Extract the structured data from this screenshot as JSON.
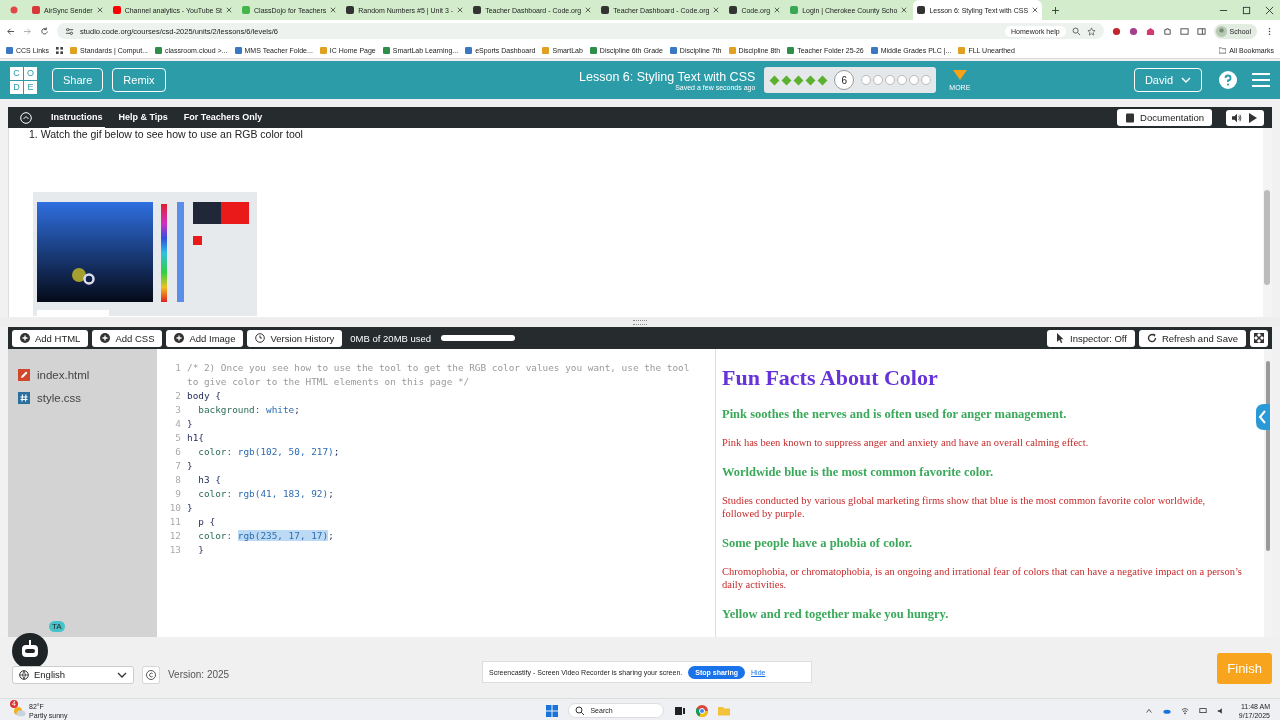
{
  "browser": {
    "tabs": [
      {
        "title": "AirSync Sender",
        "selected": false,
        "color": "#d9383a"
      },
      {
        "title": "Channel analytics - YouTube St",
        "selected": false,
        "color": "#ff0000"
      },
      {
        "title": "ClassDojo for Teachers",
        "selected": false,
        "color": "#43b649"
      },
      {
        "title": "Random Numbers #5 | Unit 3 -",
        "selected": false,
        "color": "#333333"
      },
      {
        "title": "Teacher Dashboard - Code.org",
        "selected": false,
        "color": "#333333"
      },
      {
        "title": "Teacher Dashboard - Code.org",
        "selected": false,
        "color": "#333333"
      },
      {
        "title": "Code.org",
        "selected": false,
        "color": "#333333"
      },
      {
        "title": "Login | Cherokee County Scho",
        "selected": false,
        "color": "#3aa757"
      },
      {
        "title": "Lesson 6: Styling Text with CSS",
        "selected": true,
        "color": "#333333"
      }
    ],
    "address": "studio.code.org/courses/csd-2025/units/2/lessons/6/levels/6",
    "homework_help": "Homework help",
    "profile": "School",
    "bookmarks": [
      "CCS Links",
      "Standards | Comput...",
      "classroom.cloud >...",
      "MMS Teacher Folde...",
      "IC Home Page",
      "SmartLab Learning...",
      "eSports Dashboard",
      "SmartLab",
      "Discipline 6th Grade",
      "Discipline 7th",
      "Discipline 8th",
      "Teacher Folder 25-26",
      "Middle Grades PLC |...",
      "FLL Unearthed"
    ],
    "all_bookmarks": "All Bookmarks"
  },
  "header": {
    "logo_letters": [
      "C",
      "O",
      "D",
      "E"
    ],
    "buttons": [
      "Share",
      "Remix"
    ],
    "lesson_title": "Lesson 6: Styling Text with CSS",
    "save_status": "Saved a few seconds ago",
    "levels": [
      {
        "kind": "done"
      },
      {
        "kind": "done"
      },
      {
        "kind": "done"
      },
      {
        "kind": "done"
      },
      {
        "kind": "done"
      },
      {
        "kind": "current",
        "label": "6"
      },
      {
        "kind": "todo"
      },
      {
        "kind": "todo"
      },
      {
        "kind": "todo"
      },
      {
        "kind": "todo"
      },
      {
        "kind": "todo"
      },
      {
        "kind": "todo"
      }
    ],
    "more": "MORE",
    "user": "David"
  },
  "instructions_bar": {
    "tabs": [
      {
        "label": "Instructions",
        "selected": true
      },
      {
        "label": "Help & Tips",
        "selected": false
      },
      {
        "label": "For Teachers Only",
        "selected": false
      }
    ],
    "documentation": "Documentation"
  },
  "instructions": {
    "step": "1. Watch the gif below to see how to use an RGB color tool"
  },
  "editor_toolbar": {
    "buttons": [
      "Add HTML",
      "Add CSS",
      "Add Image",
      "Version History"
    ],
    "storage": "0MB of 20MB used",
    "right_buttons": [
      "Inspector: Off",
      "Refresh and Save"
    ]
  },
  "files": [
    {
      "name": "index.html",
      "kind": "html"
    },
    {
      "name": "style.css",
      "kind": "css"
    }
  ],
  "code": [
    {
      "n": "1",
      "tokens": [
        {
          "kind": "comment",
          "text": "/* 2) Once you see how to use the tool to get the RGB color values you want, use the tool to give color to the HTML elements on this page */"
        }
      ]
    },
    {
      "n": "2",
      "tokens": [
        {
          "kind": "selector",
          "text": "body {"
        }
      ]
    },
    {
      "n": "3",
      "tokens": [
        {
          "kind": "property",
          "text": "  background: "
        },
        {
          "kind": "value",
          "text": "white"
        },
        {
          "kind": "punct",
          "text": ";"
        }
      ]
    },
    {
      "n": "4",
      "tokens": [
        {
          "kind": "punct",
          "text": "}"
        }
      ]
    },
    {
      "n": "5",
      "tokens": [
        {
          "kind": "selector",
          "text": "h1{"
        }
      ]
    },
    {
      "n": "6",
      "tokens": [
        {
          "kind": "property",
          "text": "  color: "
        },
        {
          "kind": "value",
          "text": "rgb(102, 50, 217)"
        },
        {
          "kind": "punct",
          "text": ";"
        }
      ]
    },
    {
      "n": "7",
      "tokens": [
        {
          "kind": "punct",
          "text": "}"
        }
      ]
    },
    {
      "n": "8",
      "tokens": [
        {
          "kind": "selector",
          "text": "  h3 {"
        }
      ]
    },
    {
      "n": "9",
      "tokens": [
        {
          "kind": "property",
          "text": "  color: "
        },
        {
          "kind": "value",
          "text": "rgb(41, 183, 92)"
        },
        {
          "kind": "punct",
          "text": ";"
        }
      ]
    },
    {
      "n": "10",
      "tokens": [
        {
          "kind": "punct",
          "text": "}"
        }
      ]
    },
    {
      "n": "11",
      "tokens": [
        {
          "kind": "selector",
          "text": "  p {"
        }
      ]
    },
    {
      "n": "12",
      "tokens": [
        {
          "kind": "property",
          "text": "  color: "
        },
        {
          "kind": "selection",
          "text": "rgb(235, 17, 17)"
        },
        {
          "kind": "punct",
          "text": ";"
        }
      ]
    },
    {
      "n": "13",
      "tokens": [
        {
          "kind": "punct",
          "text": "  }"
        }
      ]
    }
  ],
  "preview": [
    {
      "kind": "h1",
      "text": "Fun Facts About Color"
    },
    {
      "kind": "h3",
      "text": "Pink soothes the nerves and is often used for anger management."
    },
    {
      "kind": "p",
      "text": "Pink has been known to suppress anger and anxiety and have an overall calming effect."
    },
    {
      "kind": "h3",
      "text": "Worldwide blue is the most common favorite color."
    },
    {
      "kind": "p",
      "text": "Studies conducted by various global marketing firms show that blue is the most common favorite color worldwide, followed by purple."
    },
    {
      "kind": "h3",
      "text": "Some people have a phobia of color."
    },
    {
      "kind": "p",
      "text": "Chromophobia, or chromatophobia, is an ongoing and irrational fear of colors that can have a negative impact on a person’s daily activities."
    },
    {
      "kind": "h3",
      "text": "Yellow and red together make you hungry."
    }
  ],
  "footer": {
    "assistant_badge": "TA",
    "language": "English",
    "version": "Version: 2025",
    "finish": "Finish"
  },
  "share_notice": {
    "message": "Screencastify - Screen Video Recorder is sharing your screen.",
    "stop": "Stop sharing",
    "hide": "Hide"
  },
  "taskbar": {
    "weather_badge": "4",
    "temperature": "82°F",
    "weather": "Partly sunny",
    "search": "Search",
    "time": "11:48 AM",
    "date": "9/17/2025"
  }
}
